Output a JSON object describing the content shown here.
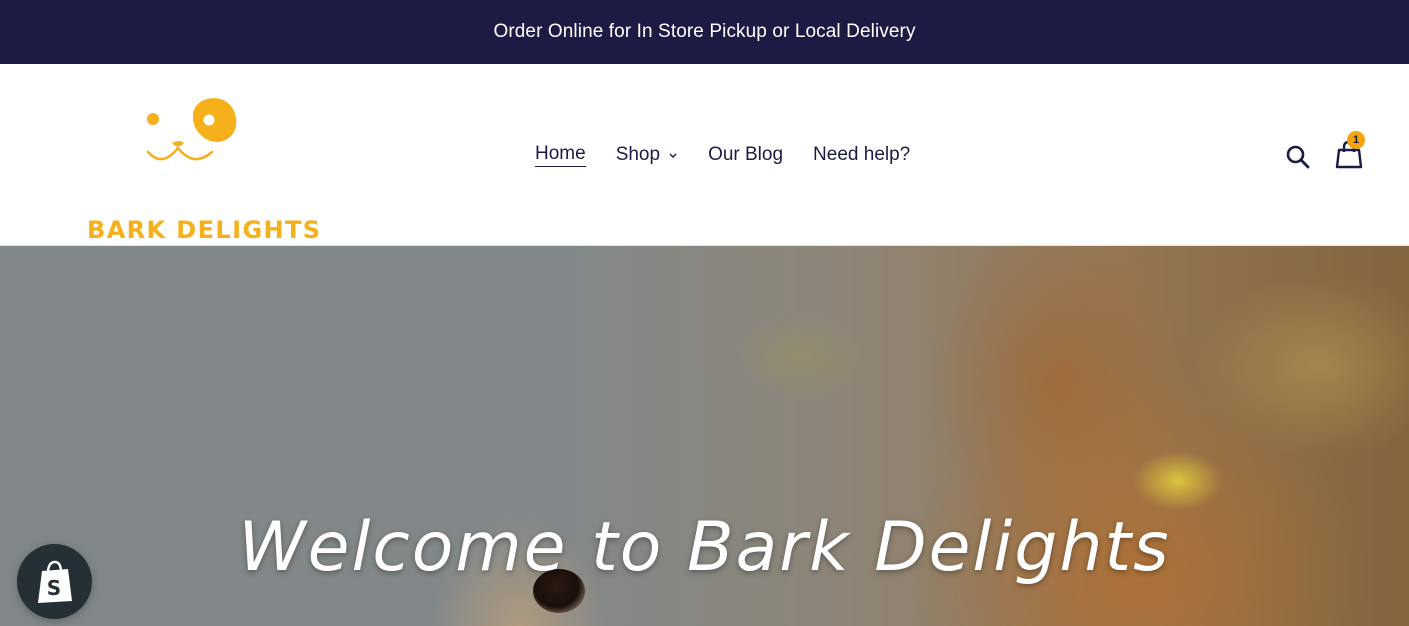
{
  "announcement": {
    "text": "Order Online for In Store Pickup or Local Delivery"
  },
  "brand": {
    "name": "BARK DELIGHTS",
    "logo_icon": "dog-face-icon",
    "color": "#f5b01b"
  },
  "nav": {
    "items": [
      {
        "label": "Home",
        "active": true
      },
      {
        "label": "Shop",
        "has_dropdown": true
      },
      {
        "label": "Our Blog"
      },
      {
        "label": "Need help?"
      }
    ]
  },
  "header_actions": {
    "search_icon": "search-icon",
    "cart_icon": "shopping-bag-icon",
    "cart_count": "1"
  },
  "hero": {
    "title": "Welcome to Bark Delights"
  },
  "shopify": {
    "icon": "shopify-bag-icon",
    "letter": "S"
  },
  "colors": {
    "navy": "#1b1b44",
    "accent": "#f5a50b"
  }
}
